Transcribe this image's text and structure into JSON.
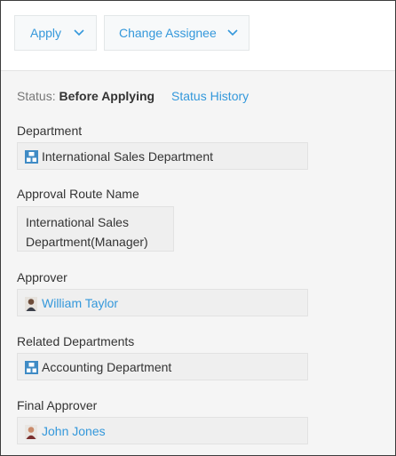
{
  "toolbar": {
    "apply_label": "Apply",
    "change_assignee_label": "Change Assignee"
  },
  "status": {
    "label": "Status:",
    "value": "Before Applying",
    "history_link": "Status History"
  },
  "fields": {
    "department": {
      "label": "Department",
      "value": "International Sales Department",
      "icon": "department-icon"
    },
    "approval_route": {
      "label": "Approval Route Name",
      "value_line1": "International Sales",
      "value_line2": "Department(Manager)"
    },
    "approver": {
      "label": "Approver",
      "value": "William Taylor",
      "icon": "user-avatar-icon"
    },
    "related_departments": {
      "label": "Related Departments",
      "value": "Accounting Department",
      "icon": "department-icon"
    },
    "final_approver": {
      "label": "Final Approver",
      "value": "John Jones",
      "icon": "user-avatar-icon"
    }
  },
  "colors": {
    "link": "#3498db",
    "panel_background": "#f5f5f5",
    "field_background": "#efefef",
    "department_icon": "#3f8bc5"
  }
}
